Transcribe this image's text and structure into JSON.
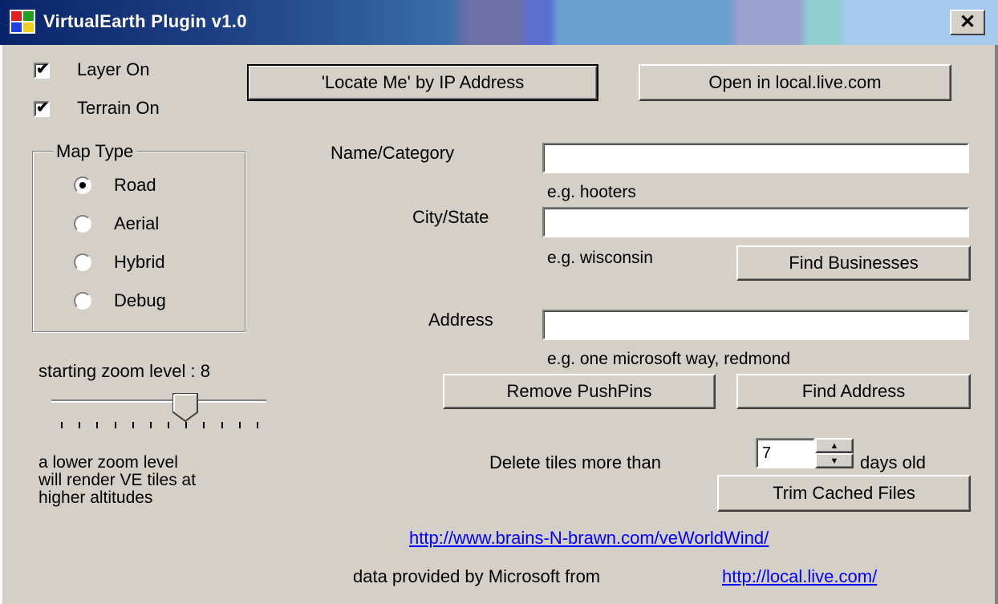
{
  "window": {
    "title": "VirtualEarth Plugin v1.0",
    "close_label": "✕"
  },
  "toggles": {
    "layer_on_label": "Layer On",
    "layer_on_checked": true,
    "terrain_on_label": "Terrain On",
    "terrain_on_checked": true
  },
  "buttons": {
    "locate_me": "'Locate Me' by IP Address",
    "open_local_live": "Open in local.live.com",
    "find_businesses": "Find Businesses",
    "remove_pushpins": "Remove PushPins",
    "find_address": "Find Address",
    "trim_cached": "Trim Cached Files"
  },
  "map_type": {
    "title": "Map Type",
    "options": [
      "Road",
      "Aerial",
      "Hybrid",
      "Debug"
    ],
    "selected": "Road"
  },
  "zoom": {
    "label": "starting zoom level : 8",
    "value": 8,
    "min": 1,
    "max": 12,
    "note_line1": "a lower zoom level",
    "note_line2": "will render VE tiles at",
    "note_line3": "higher altitudes"
  },
  "search": {
    "name_label": "Name/Category",
    "name_value": "",
    "name_hint": "e.g. hooters",
    "city_label": "City/State",
    "city_value": "",
    "city_hint": "e.g. wisconsin",
    "address_label": "Address",
    "address_value": "",
    "address_hint": "e.g. one microsoft way, redmond"
  },
  "cache": {
    "delete_prefix": "Delete tiles more than",
    "days_value": "7",
    "delete_suffix": "days old"
  },
  "footer": {
    "project_link": "http://www.brains-N-brawn.com/veWorldWind/",
    "credit_text": "data provided by Microsoft from",
    "credit_link": "http://local.live.com/"
  },
  "colors": {
    "window_bg": "#d4d0c8",
    "titlebar_start": "#0a246a",
    "titlebar_end": "#a6caf0",
    "link": "#0000ff"
  }
}
